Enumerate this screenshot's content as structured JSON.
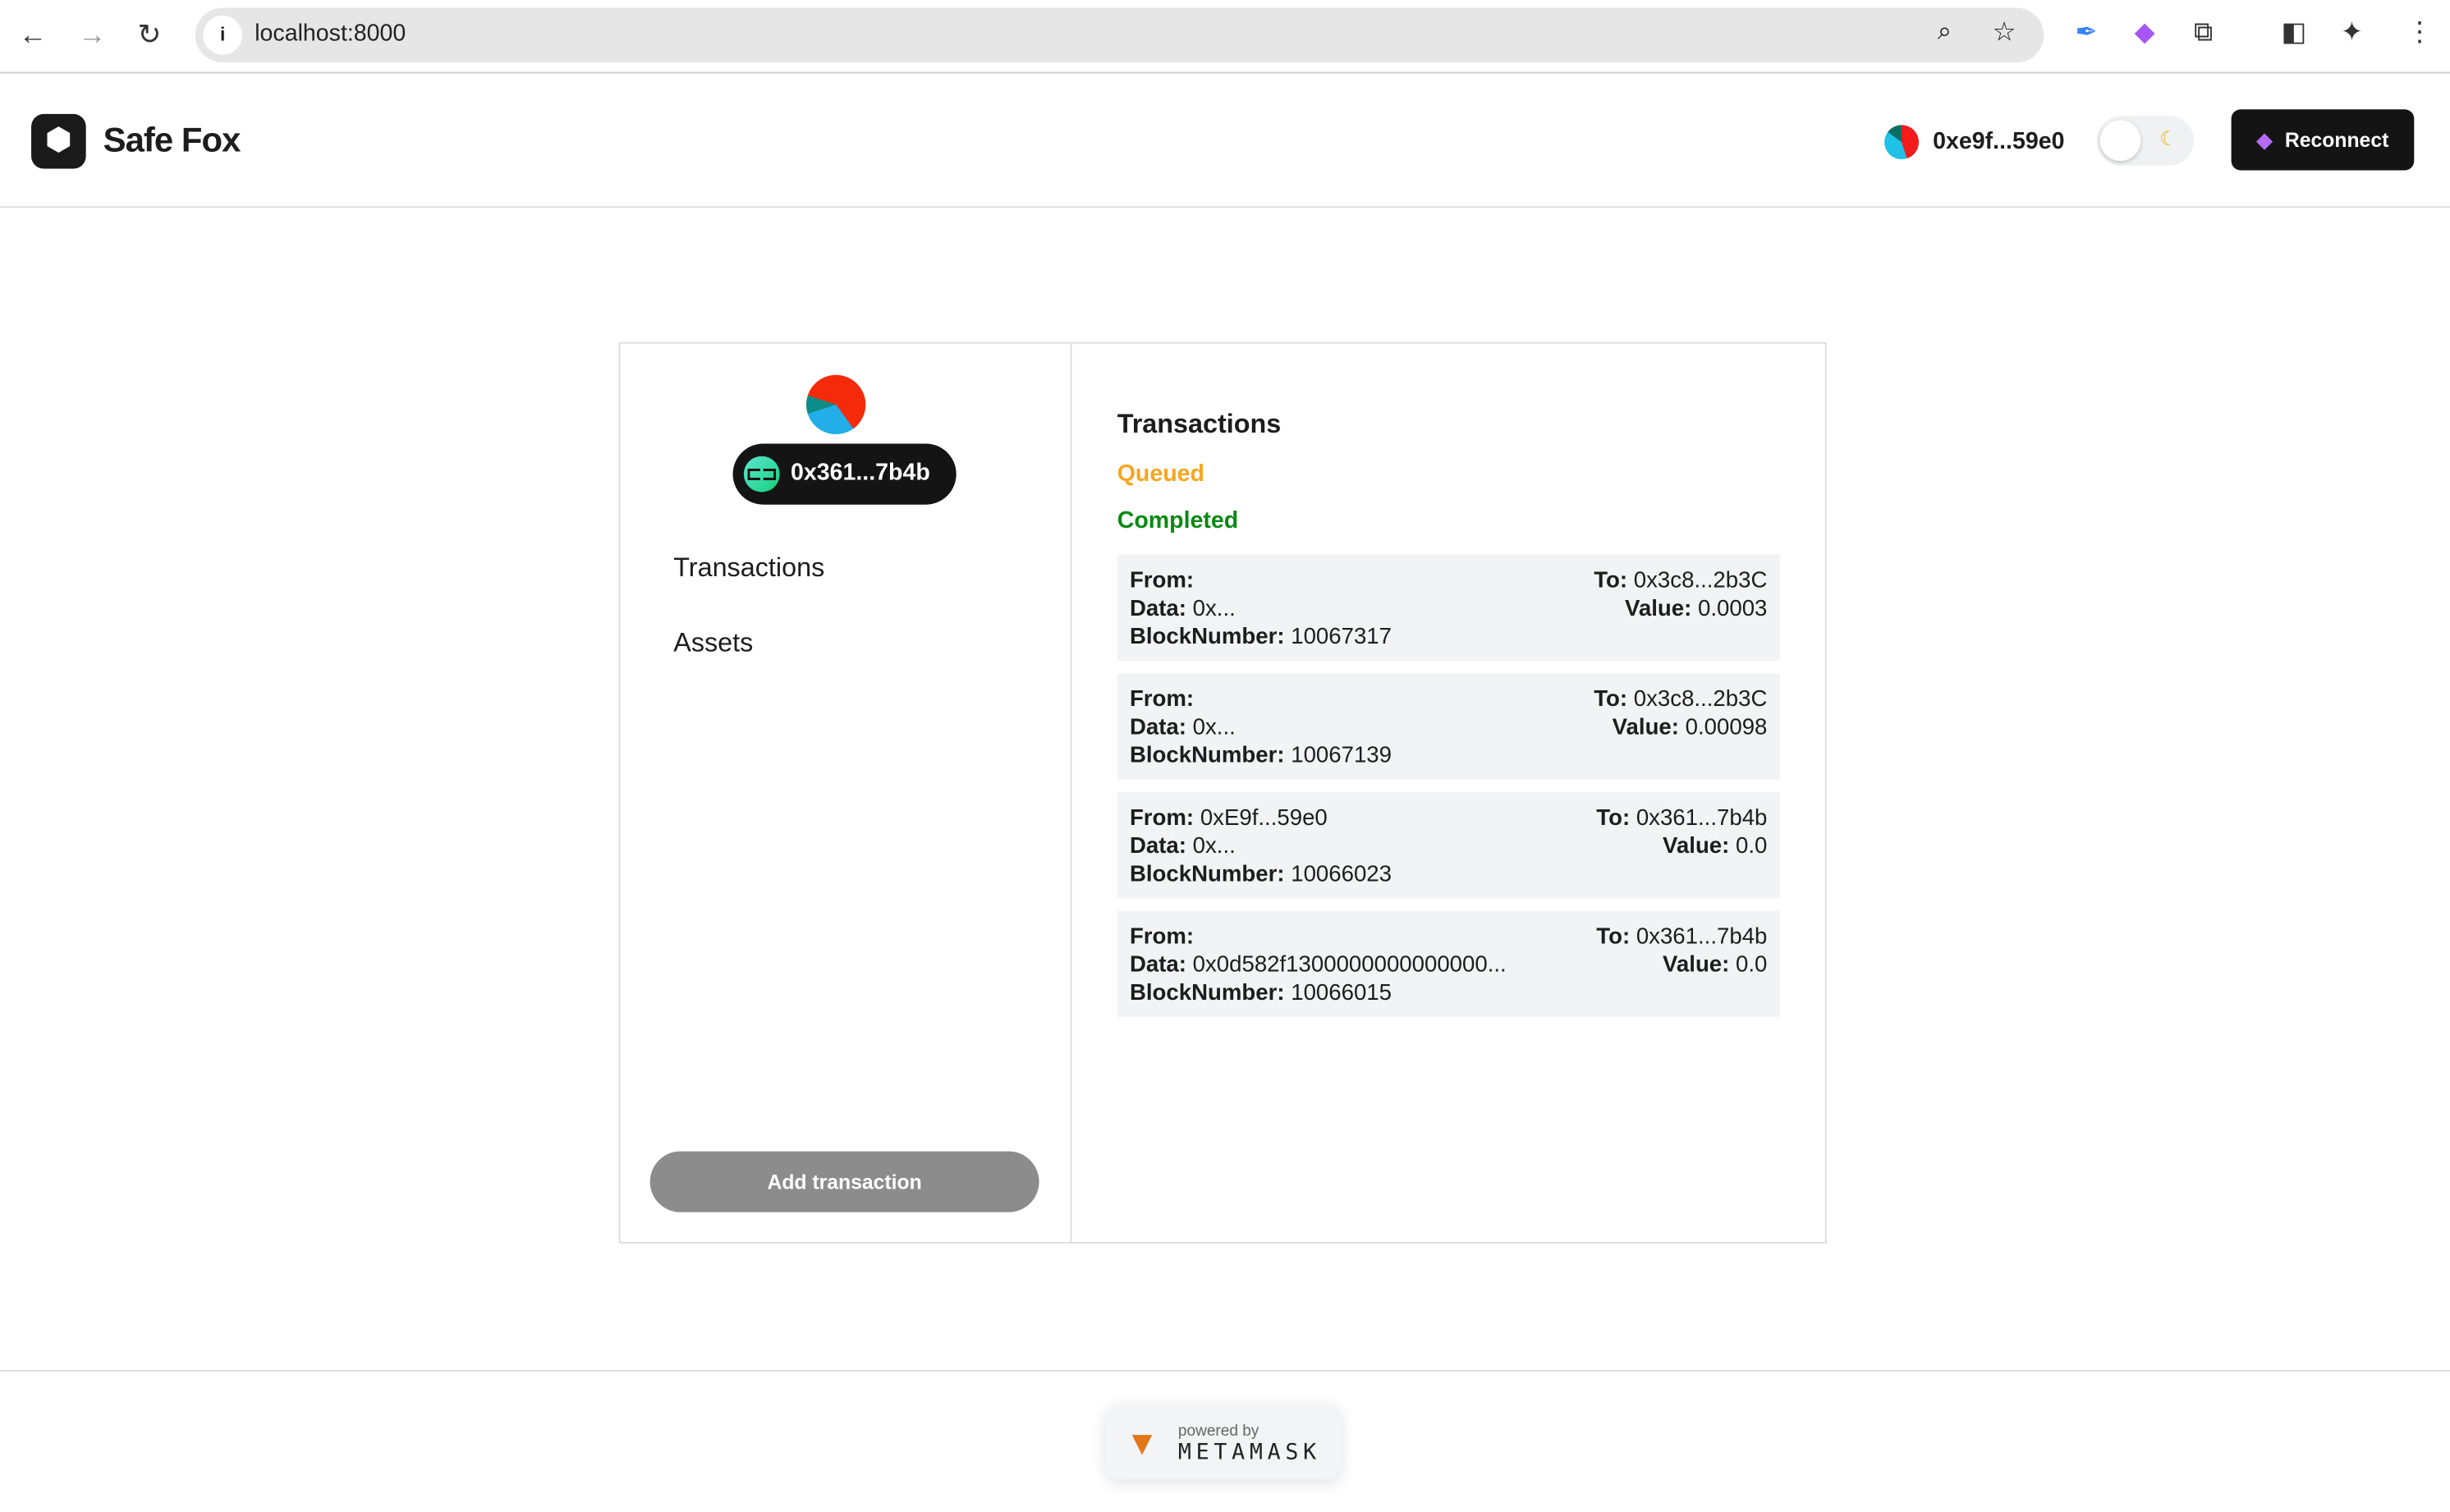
{
  "browser": {
    "url": "localhost:8000"
  },
  "header": {
    "brand": "Safe Fox",
    "account_address": "0xe9f...59e0",
    "reconnect_label": "Reconnect"
  },
  "sidebar": {
    "safe_address": "0x361...7b4b",
    "items": [
      {
        "label": "Transactions"
      },
      {
        "label": "Assets"
      }
    ],
    "add_transaction_label": "Add transaction"
  },
  "main": {
    "title": "Transactions",
    "queued_label": "Queued",
    "completed_label": "Completed",
    "labels": {
      "from": "From:",
      "data": "Data:",
      "block": "BlockNumber:",
      "to": "To:",
      "value": "Value:"
    },
    "transactions": [
      {
        "from": "",
        "data": "0x...",
        "block": "10067317",
        "to": "0x3c8...2b3C",
        "value": "0.0003"
      },
      {
        "from": "",
        "data": "0x...",
        "block": "10067139",
        "to": "0x3c8...2b3C",
        "value": "0.00098"
      },
      {
        "from": "0xE9f...59e0",
        "data": "0x...",
        "block": "10066023",
        "to": "0x361...7b4b",
        "value": "0.0"
      },
      {
        "from": "",
        "data": "0x0d582f1300000000000000...",
        "block": "10066015",
        "to": "0x361...7b4b",
        "value": "0.0"
      }
    ]
  },
  "footer": {
    "powered_by": "powered by",
    "metamask": "METAMASK"
  },
  "colors": {
    "queued": "#f5a623",
    "completed": "#0a8a12",
    "button_dark": "#141414"
  }
}
